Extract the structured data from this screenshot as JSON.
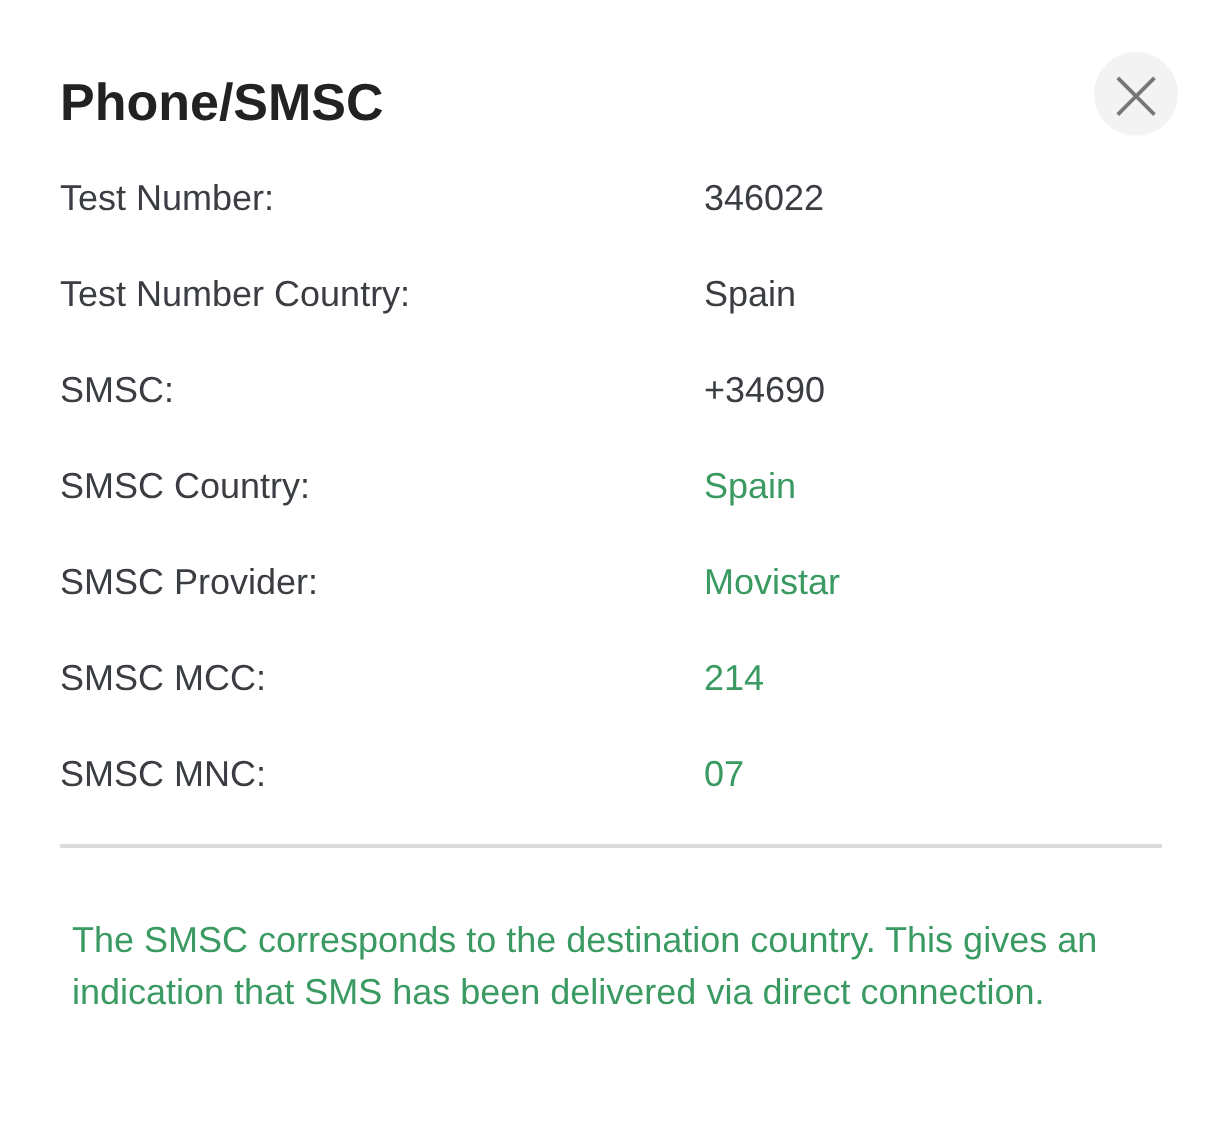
{
  "dialog": {
    "title": "Phone/SMSC",
    "close_button": "×"
  },
  "rows": [
    {
      "label": "Test Number:",
      "value": "346022",
      "highlighted": false
    },
    {
      "label": "Test Number Country:",
      "value": "Spain",
      "highlighted": false
    },
    {
      "label": "SMSC:",
      "value": "+34690",
      "highlighted": false
    },
    {
      "label": "SMSC Country:",
      "value": "Spain",
      "highlighted": true
    },
    {
      "label": "SMSC Provider:",
      "value": "Movistar",
      "highlighted": true
    },
    {
      "label": "SMSC MCC:",
      "value": "214",
      "highlighted": true
    },
    {
      "label": "SMSC MNC:",
      "value": "07",
      "highlighted": true
    }
  ],
  "note": "The SMSC corresponds to the destination country. This gives an indication that SMS has been delivered via direct connection."
}
